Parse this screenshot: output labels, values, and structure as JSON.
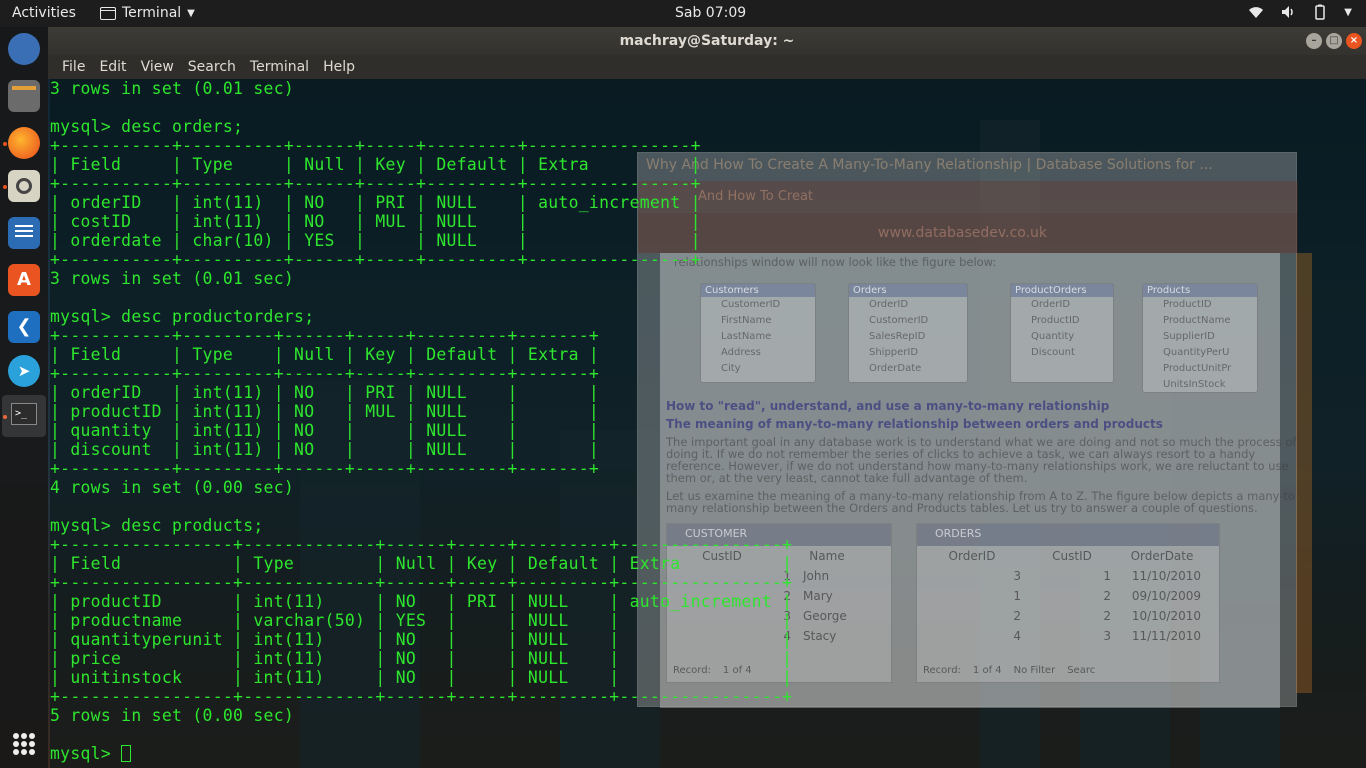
{
  "topbar": {
    "activities": "Activities",
    "app_name": "Terminal",
    "clock": "Sab 07:09"
  },
  "window": {
    "title": "machray@Saturday: ~"
  },
  "menubar": {
    "items": [
      "File",
      "Edit",
      "View",
      "Search",
      "Terminal",
      "Help"
    ]
  },
  "terminal_lines": [
    "3 rows in set (0.01 sec)",
    "",
    "mysql> desc orders;",
    "+-----------+----------+------+-----+---------+----------------+",
    "| Field     | Type     | Null | Key | Default | Extra          |",
    "+-----------+----------+------+-----+---------+----------------+",
    "| orderID   | int(11)  | NO   | PRI | NULL    | auto_increment |",
    "| costID    | int(11)  | NO   | MUL | NULL    |                |",
    "| orderdate | char(10) | YES  |     | NULL    |                |",
    "+-----------+----------+------+-----+---------+----------------+",
    "3 rows in set (0.01 sec)",
    "",
    "mysql> desc productorders;",
    "+-----------+---------+------+-----+---------+-------+",
    "| Field     | Type    | Null | Key | Default | Extra |",
    "+-----------+---------+------+-----+---------+-------+",
    "| orderID   | int(11) | NO   | PRI | NULL    |       |",
    "| productID | int(11) | NO   | MUL | NULL    |       |",
    "| quantity  | int(11) | NO   |     | NULL    |       |",
    "| discount  | int(11) | NO   |     | NULL    |       |",
    "+-----------+---------+------+-----+---------+-------+",
    "4 rows in set (0.00 sec)",
    "",
    "mysql> desc products;",
    "+-----------------+-------------+------+-----+---------+----------------+",
    "| Field           | Type        | Null | Key | Default | Extra          |",
    "+-----------------+-------------+------+-----+---------+----------------+",
    "| productID       | int(11)     | NO   | PRI | NULL    | auto_increment |",
    "| productname     | varchar(50) | YES  |     | NULL    |                |",
    "| quantityperunit | int(11)     | NO   |     | NULL    |                |",
    "| price           | int(11)     | NO   |     | NULL    |                |",
    "| unitinstock     | int(11)     | NO   |     | NULL    |                |",
    "+-----------------+-------------+------+-----+---------+----------------+",
    "5 rows in set (0.00 sec)",
    "",
    "mysql> "
  ],
  "ghost_browser": {
    "title": "Why And How To Create A Many-To-Many Relationship | Database Solutions for ...",
    "tab": "And How To Creat",
    "url": "www.databasedev.co.uk",
    "intro": "relationships window will now look like the figure below:",
    "diagram_tables": [
      {
        "name": "Customers",
        "fields": [
          "CustomerID",
          "FirstName",
          "LastName",
          "Address",
          "City"
        ]
      },
      {
        "name": "Orders",
        "fields": [
          "OrderID",
          "CustomerID",
          "SalesRepID",
          "ShipperID",
          "OrderDate"
        ]
      },
      {
        "name": "ProductOrders",
        "fields": [
          "OrderID",
          "ProductID",
          "Quantity",
          "Discount"
        ]
      },
      {
        "name": "Products",
        "fields": [
          "ProductID",
          "ProductName",
          "SupplierID",
          "QuantityPerU",
          "ProductUnitPr",
          "UnitsInStock"
        ]
      }
    ],
    "heading1": "How to \"read\", understand, and use a many-to-many relationship",
    "heading2": "The meaning of many-to-many relationship between orders and products",
    "para1": [
      "The important goal in any database work is to understand what we are doing and not so much the process of",
      "doing it. If we do not remember the series of clicks to achieve a task, we can always resort to a handy",
      "reference. However, if we do not understand how many-to-many relationships work, we are reluctant to use",
      "them or, at the very least, cannot take full advantage of them."
    ],
    "para2": [
      "Let us examine the meaning of a many-to-many relationship from A to Z. The figure below depicts a many-to-",
      "many relationship between the Orders and Products tables. Let us try to answer a couple of questions."
    ],
    "customer_table": {
      "title": "CUSTOMER",
      "headers": [
        "CustID",
        "Name"
      ],
      "rows": [
        [
          "1",
          "John"
        ],
        [
          "2",
          "Mary"
        ],
        [
          "3",
          "George"
        ],
        [
          "4",
          "Stacy"
        ]
      ],
      "record": "Record:",
      "record_pos": "1 of 4"
    },
    "orders_table": {
      "title": "ORDERS",
      "headers": [
        "OrderID",
        "CustID",
        "OrderDate"
      ],
      "rows": [
        [
          "3",
          "1",
          "11/10/2010"
        ],
        [
          "1",
          "2",
          "09/10/2009"
        ],
        [
          "2",
          "2",
          "10/10/2010"
        ],
        [
          "4",
          "3",
          "11/11/2010"
        ]
      ],
      "record": "Record:",
      "record_pos": "1 of 4",
      "filter": "No Filter",
      "search": "Searc"
    }
  },
  "colors": {
    "terminal_text": "#2ee62e",
    "topbar_bg": "#1d1d1d",
    "titlebar_bg": "#3d3c37",
    "close_button": "#e95420"
  }
}
